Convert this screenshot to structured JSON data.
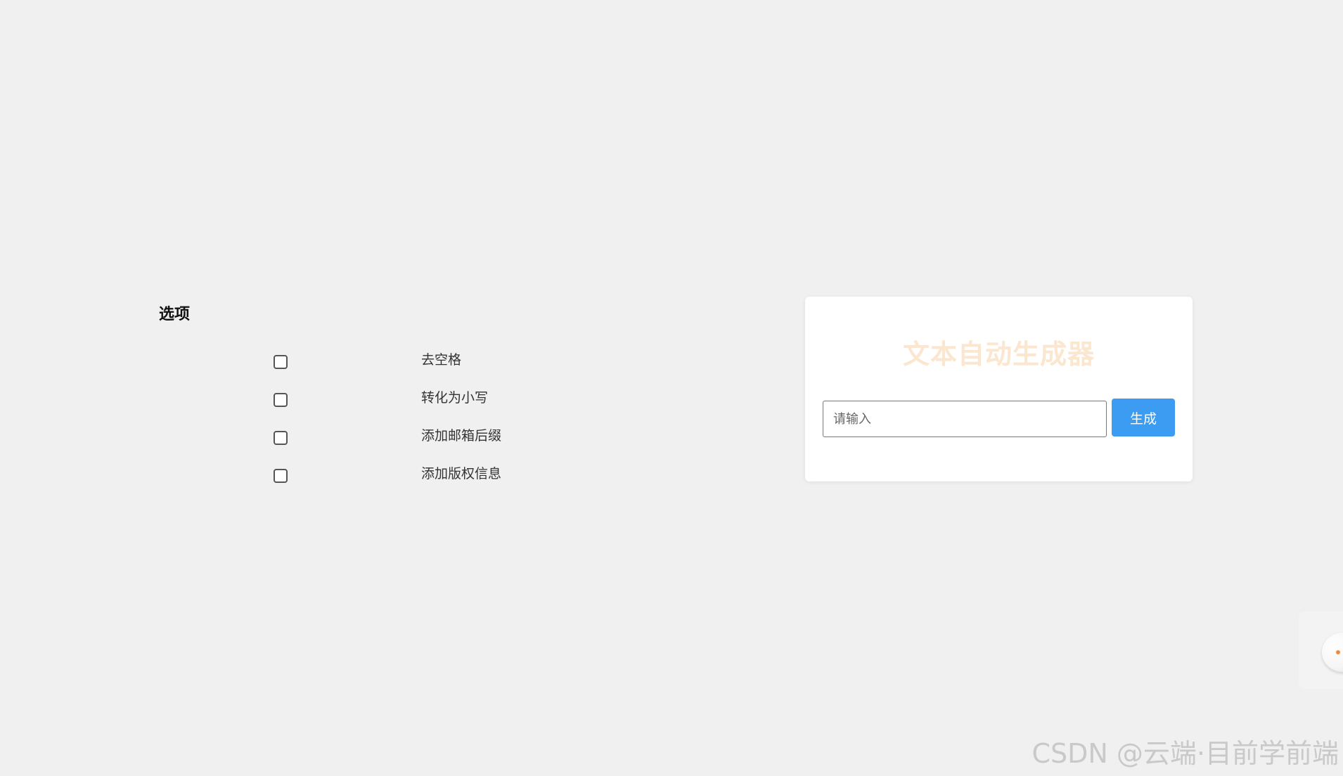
{
  "options": {
    "title": "选项",
    "items": [
      {
        "label": "去空格",
        "checked": false
      },
      {
        "label": "转化为小写",
        "checked": false
      },
      {
        "label": "添加邮箱后缀",
        "checked": false
      },
      {
        "label": "添加版权信息",
        "checked": false
      }
    ]
  },
  "generator": {
    "title": "文本自动生成器",
    "input_placeholder": "请输入",
    "input_value": "",
    "button_label": "生成",
    "title_color": "#fbe6cf",
    "button_color": "#3b9cf2"
  },
  "floating_widget": {
    "icon": "assistant-ball-icon"
  },
  "watermark": "CSDN @云端·目前学前端"
}
